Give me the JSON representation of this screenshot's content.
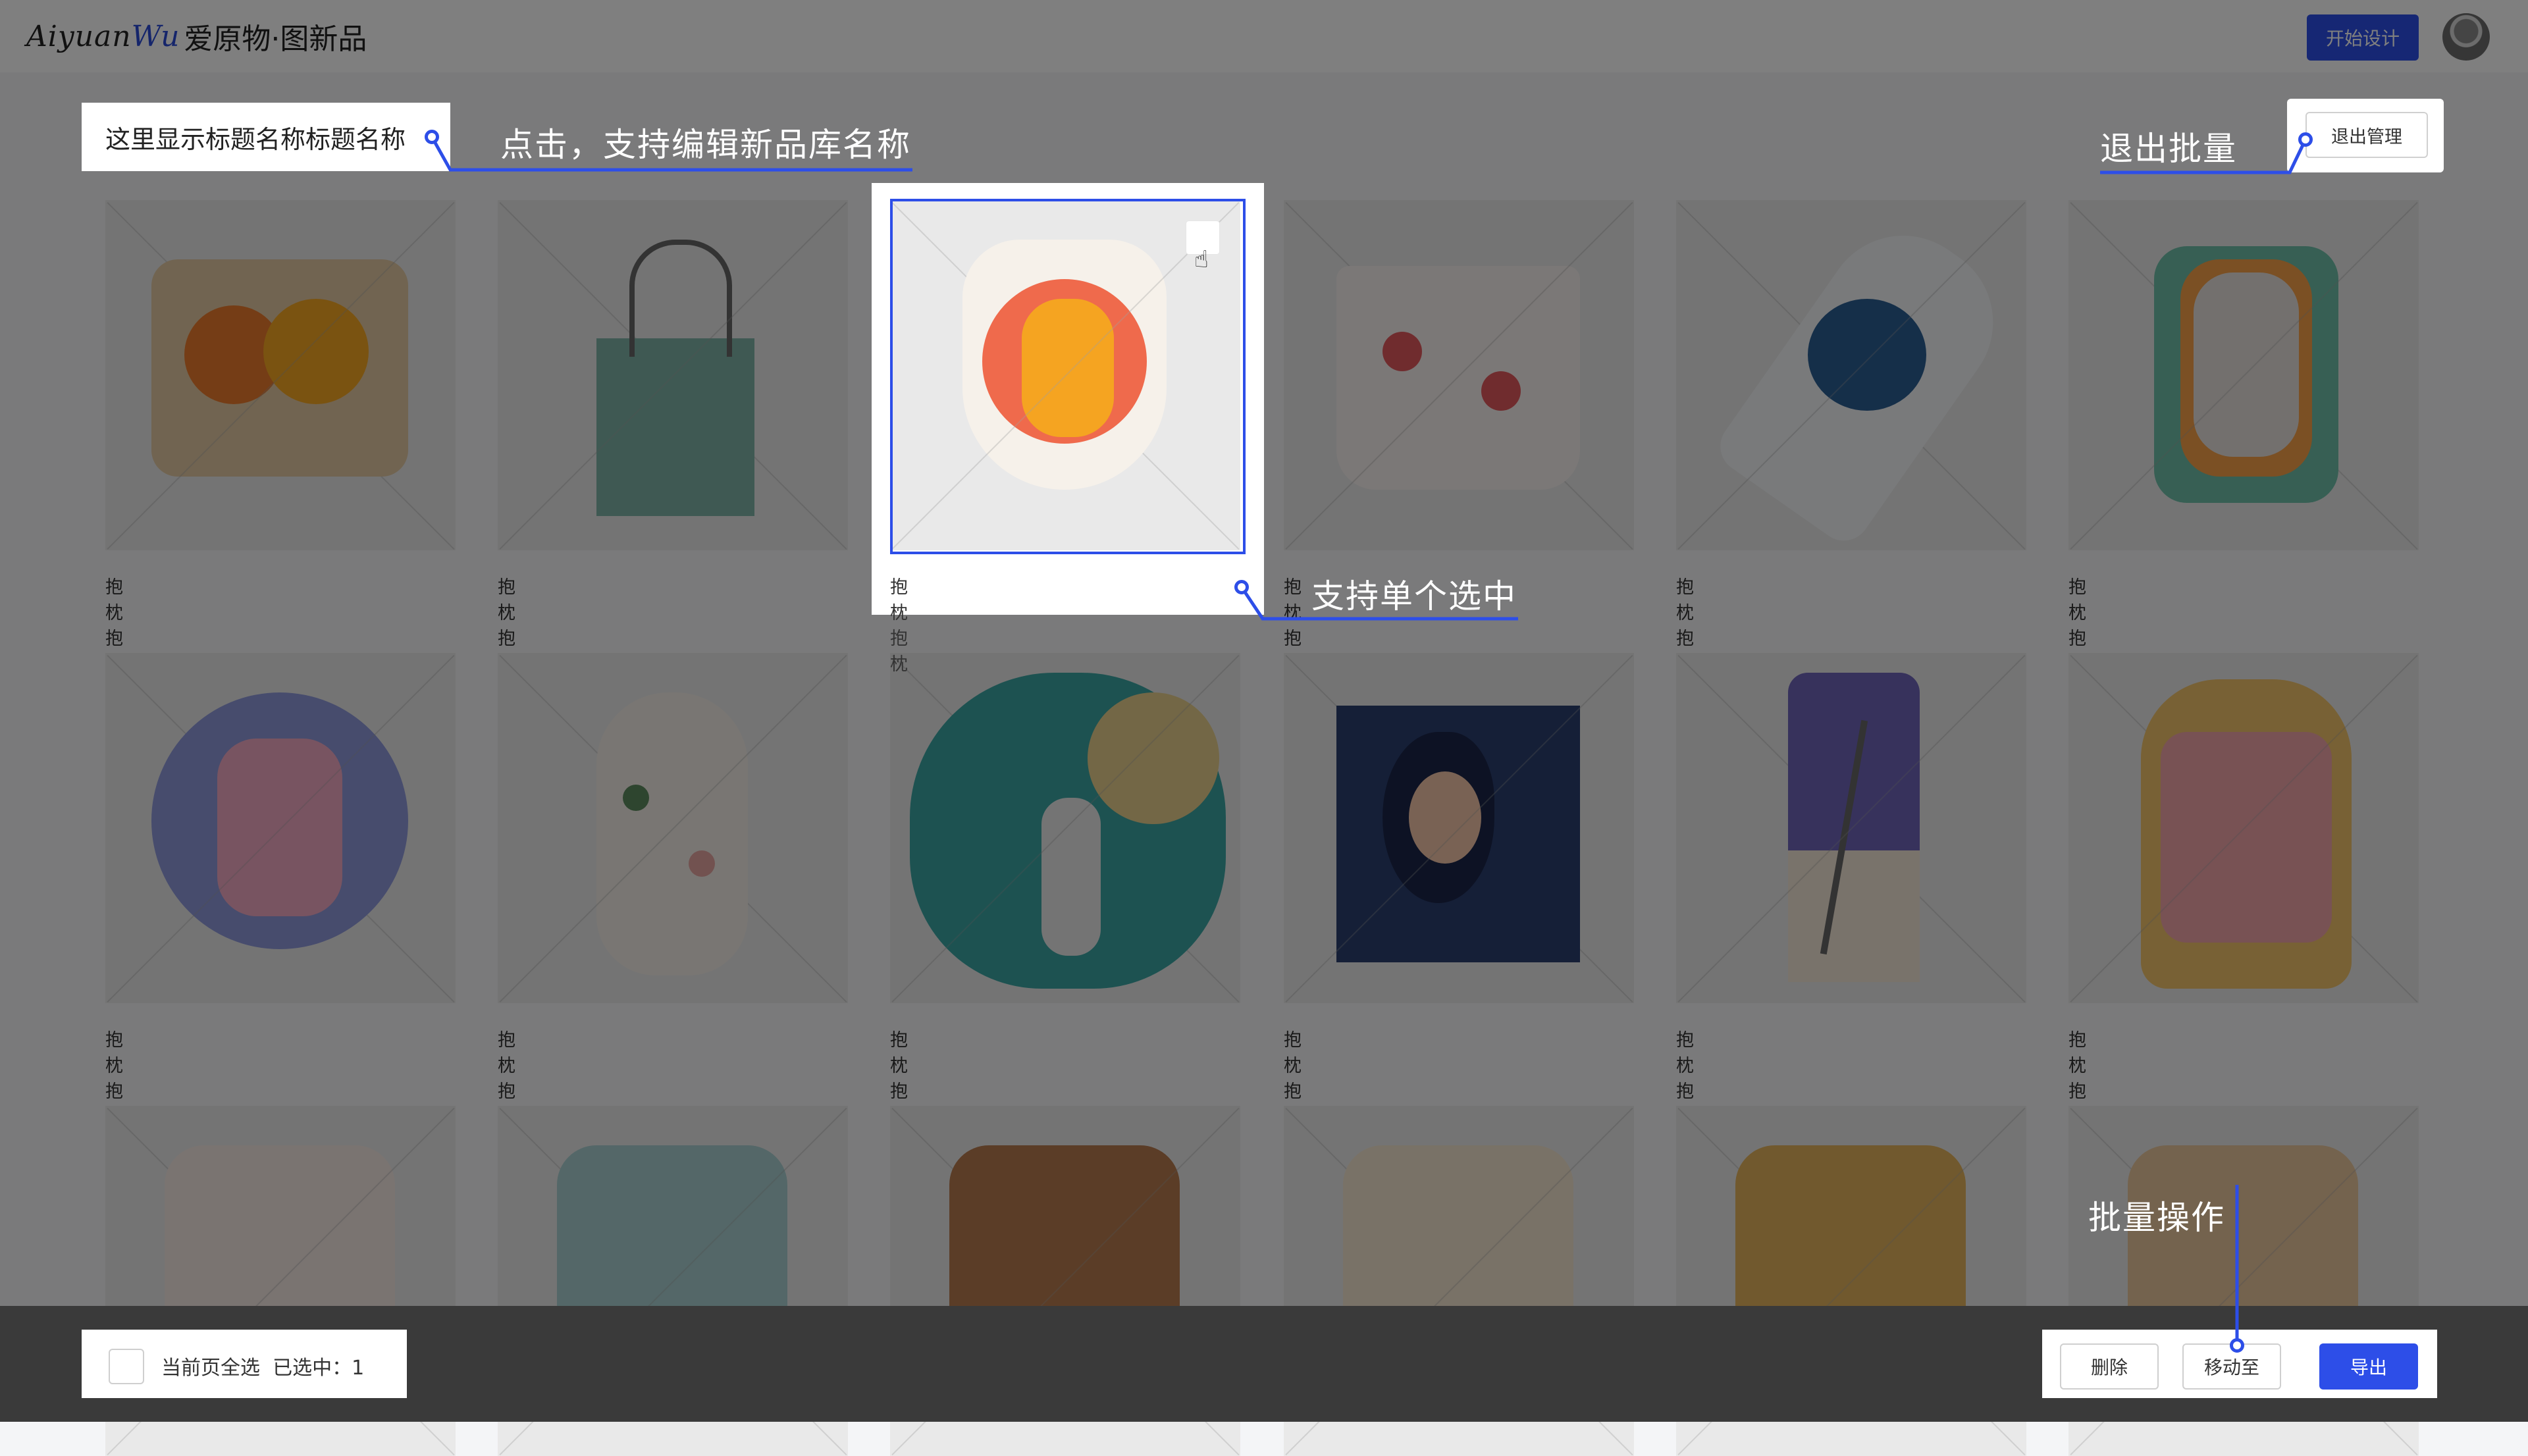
{
  "header": {
    "logo_script": "Aiyuan",
    "logo_script_accent": "Wu",
    "logo_cn": "爱原物·图新品",
    "start_design": "开始设计"
  },
  "library": {
    "title": "这里显示标题名称标题名称",
    "exit_manage": "退出管理"
  },
  "items": [
    {
      "name": "抱枕抱枕",
      "selected": false
    },
    {
      "name": "抱枕抱枕",
      "selected": false
    },
    {
      "name": "抱枕抱枕",
      "selected": true
    },
    {
      "name": "抱枕抱枕",
      "selected": false
    },
    {
      "name": "抱枕抱枕",
      "selected": false
    },
    {
      "name": "抱枕抱枕",
      "selected": false
    },
    {
      "name": "抱枕抱枕",
      "selected": false
    },
    {
      "name": "抱枕抱枕",
      "selected": false
    },
    {
      "name": "抱枕抱枕",
      "selected": false
    },
    {
      "name": "抱枕抱枕",
      "selected": false
    },
    {
      "name": "抱枕抱枕",
      "selected": false
    },
    {
      "name": "抱枕抱枕",
      "selected": false
    }
  ],
  "bottom": {
    "select_all": "当前页全选",
    "selected_count_label": "已选中：1",
    "delete": "删除",
    "move_to": "移动至",
    "export": "导出"
  },
  "annotations": {
    "edit_name": "点击，支持编辑新品库名称",
    "exit_batch": "退出批量",
    "single_select": "支持单个选中",
    "batch_ops": "批量操作"
  },
  "colors": {
    "accent": "#2d4ee8",
    "overlay": "rgba(0,0,0,0.5)"
  }
}
